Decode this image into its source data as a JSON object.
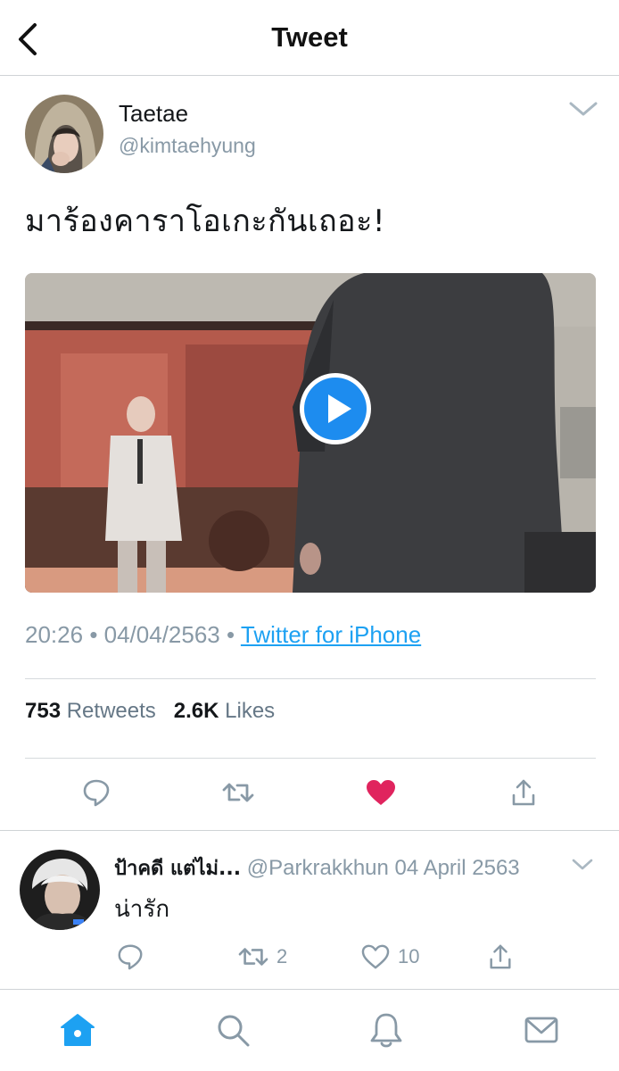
{
  "header": {
    "title": "Tweet",
    "back_icon": "chevron-left-icon"
  },
  "tweet": {
    "author_name": "Taetae",
    "author_handle": "@kimtaehyung",
    "text": "มาร้องคาราโอเกะกันเถอะ!",
    "time": "20:26",
    "date": "04/04/2563",
    "source": "Twitter for iPhone",
    "retweet_count": "753",
    "retweet_label": "Retweets",
    "like_count": "2.6K",
    "like_label": "Likes",
    "liked": true
  },
  "reply": {
    "name": "ป้าคดี แต่ไม่...",
    "handle": "@Parkrakkhun",
    "date": "04 April 2563",
    "text": "น่ารัก",
    "retweet_count": "2",
    "like_count": "10"
  },
  "colors": {
    "accent": "#1da1f2",
    "like": "#e0245e",
    "muted": "#8899a6",
    "divider": "#d6dadd"
  },
  "tabbar": {
    "items": [
      "home-icon",
      "search-icon",
      "notifications-icon",
      "messages-icon"
    ],
    "active": "home-icon"
  }
}
